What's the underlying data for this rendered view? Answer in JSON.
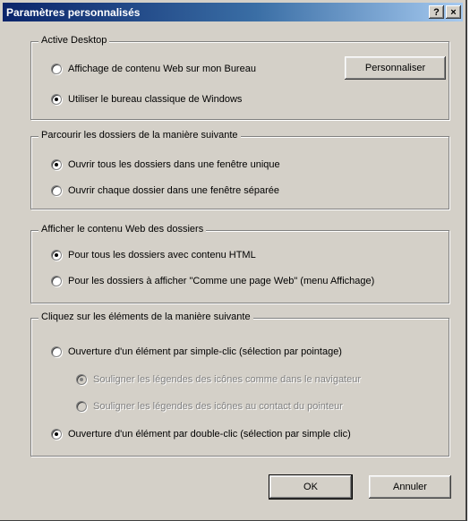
{
  "window": {
    "title": "Paramètres personnalisés",
    "help_label": "?",
    "close_label": "×"
  },
  "groups": [
    {
      "legend": "Active Desktop",
      "options": [
        {
          "label": "Affichage de contenu Web sur mon Bureau",
          "checked": false,
          "enabled": true
        },
        {
          "label": "Utiliser le bureau classique de Windows",
          "checked": true,
          "enabled": true
        }
      ],
      "button_label": "Personnaliser"
    },
    {
      "legend": "Parcourir les dossiers de la manière suivante",
      "options": [
        {
          "label": "Ouvrir tous les dossiers dans une fenêtre unique",
          "checked": true,
          "enabled": true
        },
        {
          "label": "Ouvrir chaque dossier dans une fenêtre séparée",
          "checked": false,
          "enabled": true
        }
      ]
    },
    {
      "legend": "Afficher le contenu Web des dossiers",
      "options": [
        {
          "label": "Pour tous les dossiers avec contenu HTML",
          "checked": true,
          "enabled": true
        },
        {
          "label": "Pour les dossiers à afficher \"Comme une page Web\" (menu Affichage)",
          "checked": false,
          "enabled": true
        }
      ]
    },
    {
      "legend": "Cliquez sur les éléments de la manière suivante",
      "options": [
        {
          "label": "Ouverture d'un élément par simple-clic (sélection par pointage)",
          "checked": false,
          "enabled": true
        },
        {
          "label": "Souligner les légendes des icônes comme dans le navigateur",
          "checked": true,
          "enabled": false
        },
        {
          "label": "Souligner les légendes des icônes au contact du pointeur",
          "checked": false,
          "enabled": false
        },
        {
          "label": "Ouverture d'un élément par double-clic (sélection par simple clic)",
          "checked": true,
          "enabled": true
        }
      ]
    }
  ],
  "footer": {
    "ok_label": "OK",
    "cancel_label": "Annuler"
  }
}
